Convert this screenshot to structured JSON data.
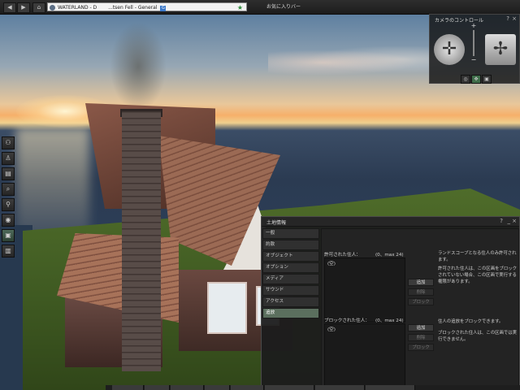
{
  "browser": {
    "back_icon": "back-arrow-icon",
    "forward_icon": "forward-arrow-icon",
    "home_icon": "home-icon",
    "location": "WATERLAND - D",
    "location_rest": "...tsen Fell - General",
    "maturity_badge": "G",
    "favorite_icon": "star-icon",
    "search_placeholder": "お気に入りバー"
  },
  "left_toolbar": {
    "items": [
      {
        "name": "people-icon",
        "glyph": "👥"
      },
      {
        "name": "appearance-icon",
        "glyph": "👕"
      },
      {
        "name": "inventory-icon",
        "glyph": "▤"
      },
      {
        "name": "search-icon",
        "glyph": "⌕"
      },
      {
        "name": "place-icon",
        "glyph": "⚲"
      },
      {
        "name": "compass-icon",
        "glyph": "◉"
      },
      {
        "name": "camera-icon",
        "glyph": "▣"
      },
      {
        "name": "map-icon",
        "glyph": "▥"
      }
    ],
    "active_index": 6
  },
  "camera_controls": {
    "title": "カメラのコントロール",
    "help": "?",
    "close": "×",
    "zoom_plus": "+",
    "zoom_minus": "−",
    "modes": [
      "◎",
      "✥",
      "▣"
    ],
    "active_mode": 1
  },
  "land_panel": {
    "title": "土地情報",
    "help": "?",
    "minimize": "_",
    "close": "×",
    "tabs": [
      "一般",
      "約款",
      "オブジェクト",
      "オプション",
      "メディア",
      "サウンド",
      "アクセス",
      "追放"
    ],
    "active_tab": 7,
    "allowed": {
      "label": "許可された住人：",
      "max": "(0、max 24)",
      "items": [
        "(空)"
      ],
      "add": "追加",
      "remove": "削除",
      "block": "ブロック"
    },
    "allowed_note1": "ランドスコープとなる住人のみ許可されます。",
    "allowed_note2": "許可された住人は、この区画をブロックされていない場合、この区画で実行する権限があります。",
    "blocked": {
      "label": "ブロックされた住人：",
      "max": "(0、max 24)",
      "items": [
        "(空)"
      ],
      "add": "追加",
      "remove": "削除",
      "block": "ブロック"
    },
    "blocked_note1": "住人の追放をブロックできます。",
    "blocked_note2": "ブロックされた住人は、この区画では実行できません。"
  }
}
